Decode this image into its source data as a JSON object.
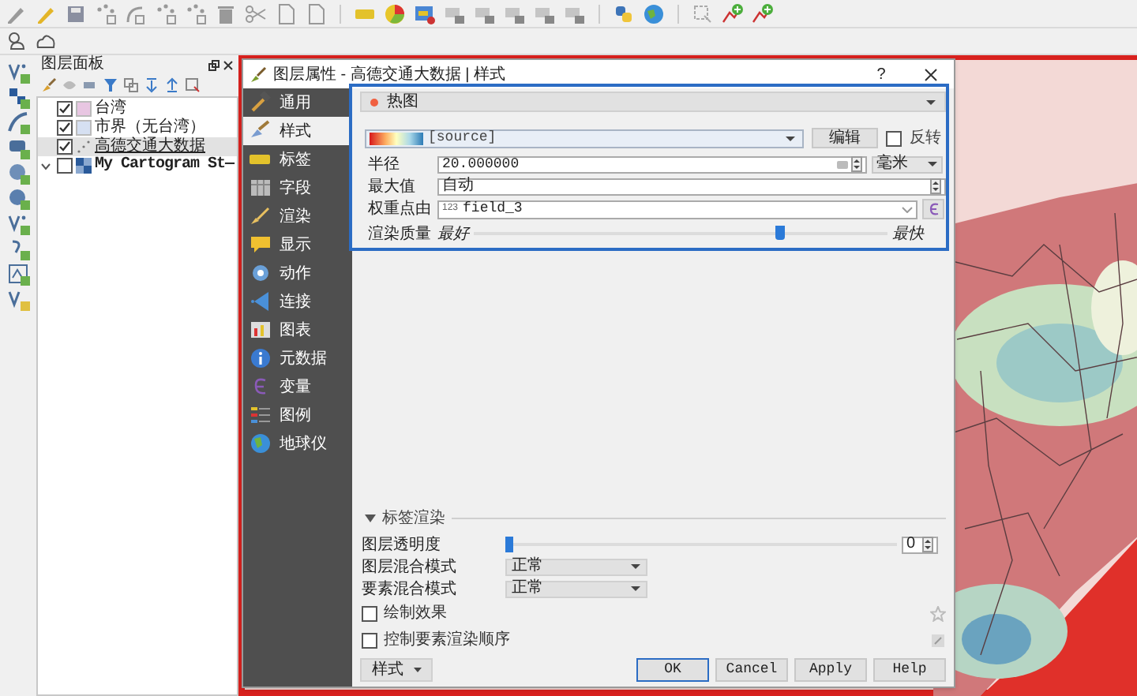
{
  "layers_panel": {
    "title": "图层面板",
    "layers": [
      {
        "name": "台湾",
        "kind": "polygon",
        "color": "#e8c6e2",
        "checked": true,
        "selected": false
      },
      {
        "name": "市界（无台湾）",
        "kind": "polygon",
        "color": "#d6e0f2",
        "checked": true,
        "selected": false
      },
      {
        "name": "高德交通大数据",
        "kind": "point",
        "checked": true,
        "selected": true
      },
      {
        "name": "My Cartogram St—",
        "kind": "raster",
        "checked": false,
        "selected": false
      }
    ]
  },
  "dialog": {
    "title": "图层属性 - 高德交通大数据 | 样式",
    "help": "?",
    "sidebar": [
      {
        "label": "通用",
        "selected": false
      },
      {
        "label": "样式",
        "selected": true
      },
      {
        "label": "标签",
        "selected": false
      },
      {
        "label": "字段",
        "selected": false
      },
      {
        "label": "渲染",
        "selected": false
      },
      {
        "label": "显示",
        "selected": false
      },
      {
        "label": "动作",
        "selected": false
      },
      {
        "label": "连接",
        "selected": false
      },
      {
        "label": "图表",
        "selected": false
      },
      {
        "label": "元数据",
        "selected": false
      },
      {
        "label": "变量",
        "selected": false
      },
      {
        "label": "图例",
        "selected": false
      },
      {
        "label": "地球仪",
        "selected": false
      }
    ],
    "renderer": {
      "type": "热图",
      "color_ramp": {
        "value": "[source]"
      },
      "edit_button": "编辑",
      "invert": {
        "label": "反转",
        "checked": false
      },
      "radius": {
        "label": "半径",
        "value": "20.000000",
        "unit": "毫米"
      },
      "max_value": {
        "label": "最大值",
        "value": "自动"
      },
      "weight": {
        "label": "权重点由",
        "type_badge": "123",
        "value": "field_3"
      },
      "quality": {
        "label": "渲染质量",
        "min_label": "最好",
        "max_label": "最快",
        "level": 0.74
      }
    },
    "layer_rendering": {
      "title": "标签渲染",
      "expanded": true,
      "opacity": {
        "label": "图层透明度",
        "level": 0,
        "value": "0"
      },
      "layer_blend": {
        "label": "图层混合模式",
        "value": "正常"
      },
      "feature_blend": {
        "label": "要素混合模式",
        "value": "正常"
      },
      "options": [
        {
          "label": "绘制效果",
          "checked": false
        },
        {
          "label": "控制要素渲染顺序",
          "checked": false
        }
      ]
    },
    "style_menu": "样式",
    "buttons": [
      {
        "label": "OK",
        "default": true
      },
      {
        "label": "Cancel",
        "default": false
      },
      {
        "label": "Apply",
        "default": false
      },
      {
        "label": "Help",
        "default": false
      }
    ]
  }
}
